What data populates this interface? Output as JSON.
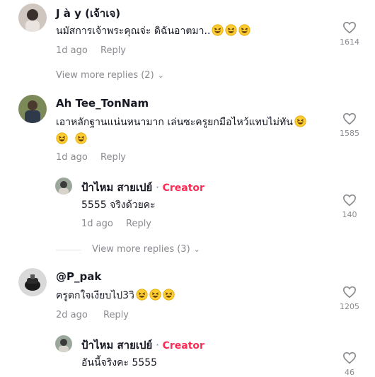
{
  "comments": [
    {
      "username": "J à y (เจ้าเจ)",
      "text": "นมัสการเจ้าพระคุณจ่ะ ดิฉันอาตมา..",
      "time": "1d ago",
      "reply_label": "Reply",
      "likes": "1614",
      "view_more": "View more replies (2)"
    },
    {
      "username": "Ah Tee_TonNam",
      "text": "เอาหลักฐานแน่นหนามาก เล่นซะครูยกมือไหว้แทบไม่ทัน",
      "time": "1d ago",
      "reply_label": "Reply",
      "likes": "1585",
      "reply": {
        "username": "ป้าไหม สายเปย์",
        "dot": " · ",
        "badge": "Creator",
        "text": "5555 จริงด้วยคะ",
        "time": "1d ago",
        "reply_label": "Reply",
        "likes": "140"
      },
      "view_more": "View more replies (3)"
    },
    {
      "username": "@P_pak",
      "text": "ครูตกใจเงียบไป3วิ",
      "time": "2d ago",
      "reply_label": "Reply",
      "likes": "1205",
      "reply": {
        "username": "ป้าไหม สายเปย์",
        "dot": " · ",
        "badge": "Creator",
        "text": "อันนี้จริงคะ 5555",
        "likes": "46"
      }
    }
  ],
  "icons": {
    "like": "heart-outline-icon",
    "emoji": "grinning-squinting-face-emoji",
    "expand": "chevron-down-icon"
  },
  "colors": {
    "creator_badge": "#fe2c55",
    "secondary_text": "#8a8b91"
  }
}
